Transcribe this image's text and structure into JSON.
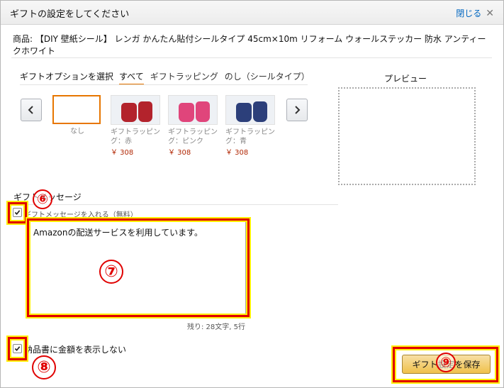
{
  "dialog": {
    "title": "ギフトの設定をしてください",
    "close_label": "閉じる",
    "close_icon": "close-x-icon"
  },
  "product": {
    "text": "商品: 【DIY 壁紙シール】 レンガ かんたん貼付シールタイプ 45cm×10m リフォーム ウォールステッカー 防水 アンティークホワイト"
  },
  "gift_options": {
    "label": "ギフトオプションを選択",
    "tabs": [
      {
        "label": "すべて",
        "active": true
      },
      {
        "label": "ギフトラッピング",
        "active": false
      },
      {
        "label": "のし（シールタイプ）",
        "active": false
      }
    ],
    "items": [
      {
        "name": "なし",
        "price": "",
        "selected": true,
        "color": ""
      },
      {
        "name": "ギフトラッピング：赤",
        "price": "￥ 308",
        "selected": false,
        "color": "#b3232c"
      },
      {
        "name": "ギフトラッピング：ピンク",
        "price": "￥ 308",
        "selected": false,
        "color": "#e0457b"
      },
      {
        "name": "ギフトラッピング：青",
        "price": "￥ 308",
        "selected": false,
        "color": "#2c3f7a"
      }
    ]
  },
  "preview": {
    "title": "プレビュー"
  },
  "gift_message": {
    "section_title": "ギフトメッセージ",
    "include_label": "ギフトメッセージを入れる（無料）",
    "include_checked": true,
    "message": "Amazonの配送サービスを利用しています。",
    "remaining": "残り: 28文字, 5行"
  },
  "invoice": {
    "label": "納品書に金額を表示しない",
    "checked": true
  },
  "save_button": {
    "label": "ギフト設定を保存"
  },
  "annotations": {
    "markers": [
      "⑥",
      "⑦",
      "⑧",
      "⑨"
    ],
    "highlight_color": "#e00000",
    "highlight_glow": "#ffee00"
  }
}
